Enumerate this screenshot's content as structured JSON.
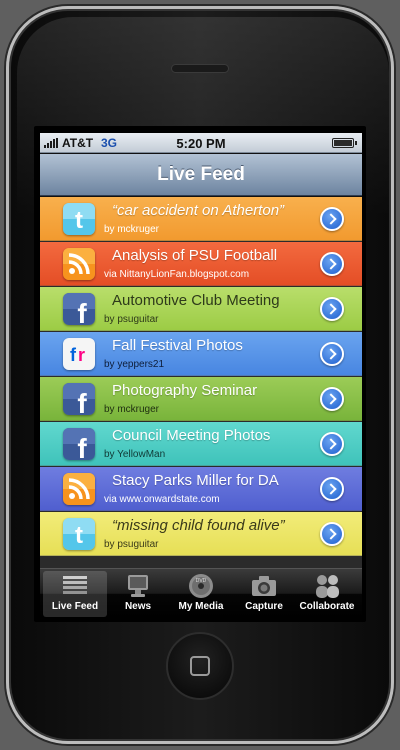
{
  "statusbar": {
    "carrier": "AT&T",
    "network": "3G",
    "time": "5:20 PM"
  },
  "navbar": {
    "title": "Live Feed"
  },
  "feed": [
    {
      "icon": "twitter-icon",
      "title": "“car accident on Atherton”",
      "subtitle": "by mckruger",
      "style": "quote",
      "color": "#f5a63f"
    },
    {
      "icon": "rss-icon",
      "title": "Analysis of PSU Football",
      "subtitle": "via NittanyLionFan.blogspot.com",
      "style": "normal",
      "color": "#ea5a30"
    },
    {
      "icon": "facebook-icon",
      "title": "Automotive Club Meeting",
      "subtitle": "by psuguitar",
      "style": "normal",
      "color": "#acd55a"
    },
    {
      "icon": "flickr-icon",
      "title": "Fall Festival Photos",
      "subtitle": "by yeppers21",
      "style": "normal",
      "color": "#5b97e8"
    },
    {
      "icon": "facebook-icon",
      "title": "Photography Seminar",
      "subtitle": "by mckruger",
      "style": "normal",
      "color": "#8bc34a"
    },
    {
      "icon": "facebook-icon",
      "title": "Council Meeting Photos",
      "subtitle": "by YellowMan",
      "style": "normal",
      "color": "#4fcdc4"
    },
    {
      "icon": "rss-icon",
      "title": "Stacy Parks Miller for DA",
      "subtitle": "via www.onwardstate.com",
      "style": "normal",
      "color": "#5f6ed8"
    },
    {
      "icon": "twitter-icon",
      "title": "“missing child found alive”",
      "subtitle": "by psuguitar",
      "style": "quote",
      "color": "#ece668"
    }
  ],
  "tabbar": [
    {
      "label": "Live Feed",
      "icon": "list-icon",
      "active": true
    },
    {
      "label": "News",
      "icon": "monitor-icon",
      "active": false
    },
    {
      "label": "My Media",
      "icon": "dvd-icon",
      "active": false
    },
    {
      "label": "Capture",
      "icon": "camera-icon",
      "active": false
    },
    {
      "label": "Collaborate",
      "icon": "people-icon",
      "active": false
    }
  ]
}
